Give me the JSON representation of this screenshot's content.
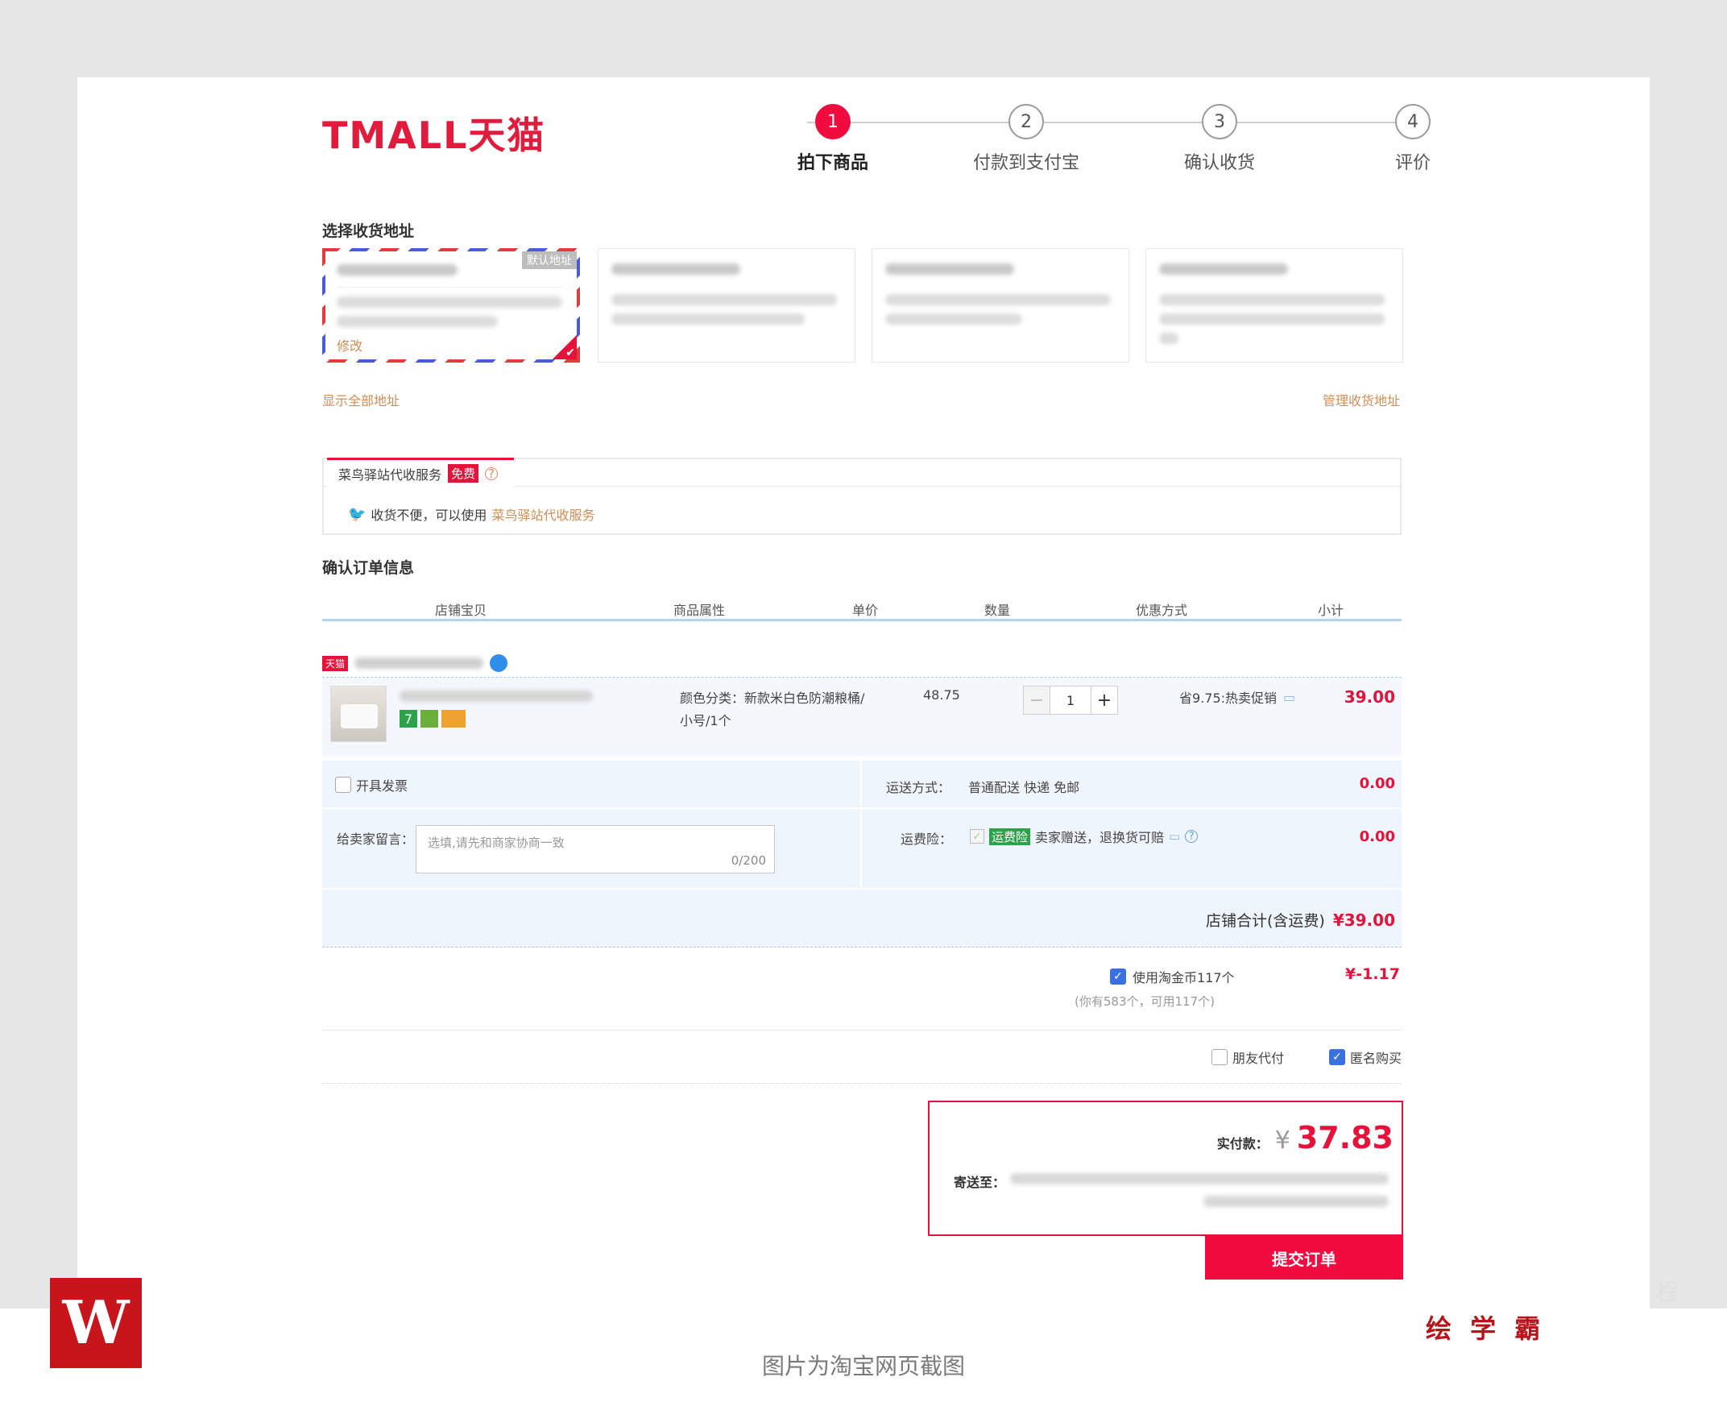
{
  "brand": {
    "logo_text": "TMALL天猫",
    "accent_color": "#f10b3f",
    "link_color": "#d28d55"
  },
  "steps": [
    {
      "number": "1",
      "label": "拍下商品",
      "active": true
    },
    {
      "number": "2",
      "label": "付款到支付宝",
      "active": false
    },
    {
      "number": "3",
      "label": "确认收货",
      "active": false
    },
    {
      "number": "4",
      "label": "评价",
      "active": false
    }
  ],
  "address": {
    "section_title": "选择收货地址",
    "default_badge": "默认地址",
    "edit_link": "修改",
    "show_all_link": "显示全部地址",
    "manage_link": "管理收货地址"
  },
  "cainiao": {
    "tab_label": "菜鸟驿站代收服务",
    "free_badge": "免费",
    "help_icon": "question-circle-icon",
    "notice_prefix": "收货不便，可以使用",
    "notice_link": "菜鸟驿站代收服务"
  },
  "order": {
    "section_title": "确认订单信息",
    "columns": [
      "店铺宝贝",
      "商品属性",
      "单价",
      "数量",
      "优惠方式",
      "小计"
    ],
    "shop_badge": "天猫",
    "item": {
      "attr_line1": "颜色分类：新款米白色防潮粮桶/",
      "attr_line2": "小号/1个",
      "unit_price": "48.75",
      "quantity": "1",
      "minus": "−",
      "plus": "+",
      "promo": "省9.75:热卖促销",
      "subtotal": "39.00"
    },
    "invoice_label": "开具发票",
    "shipping_label": "运送方式：",
    "shipping_value": "普通配送 快递 免邮",
    "shipping_fee": "0.00",
    "message_label": "给卖家留言：",
    "message_placeholder": "选填,请先和商家协商一致",
    "message_count": "0/200",
    "insurance_label": "运费险：",
    "insurance_tag": "运费险",
    "insurance_desc": "卖家赠送，退换货可赔",
    "insurance_fee": "0.00",
    "shop_total_label": "店铺合计(含运费)",
    "shop_total_value": "¥39.00"
  },
  "coins": {
    "label": "使用淘金币117个",
    "note": "(你有583个，可用117个)",
    "discount": "¥-1.17"
  },
  "options": {
    "friend_pay": "朋友代付",
    "anonymous": "匿名购买"
  },
  "summary": {
    "paid_label": "实付款：",
    "currency": "¥",
    "amount": "37.83",
    "ship_to_label": "寄送至："
  },
  "submit_label": "提交订单",
  "footer": {
    "logo_letter": "W",
    "watermark_text": "程",
    "brand_text": "绘 学 霸",
    "caption": "图片为淘宝网页截图"
  }
}
